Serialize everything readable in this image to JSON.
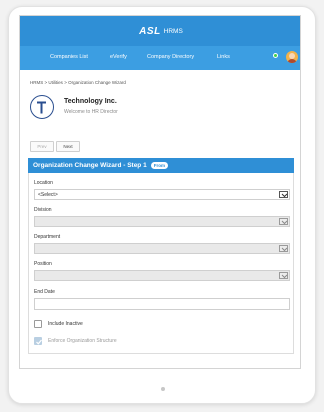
{
  "app": {
    "brand_logo": "ASL",
    "brand_name": "HRMS"
  },
  "nav": {
    "items": [
      {
        "label": "Companies List"
      },
      {
        "label": "eVerify"
      },
      {
        "label": "Company Directory"
      },
      {
        "label": "Links"
      }
    ]
  },
  "breadcrumb": {
    "items": [
      "HRMS",
      ">",
      "Utilities",
      ">",
      "Organization Change Wizard"
    ]
  },
  "company": {
    "logo_letter": "T",
    "name": "Technology Inc.",
    "welcome": "Welcome to HR Director"
  },
  "buttons": {
    "prev": "Prev",
    "next": "Next"
  },
  "wizard": {
    "title": "Organization Change Wizard - Step 1",
    "badge": "From"
  },
  "form": {
    "location": {
      "label": "Location",
      "value": "<Select>"
    },
    "division": {
      "label": "Division",
      "value": ""
    },
    "department": {
      "label": "Department",
      "value": ""
    },
    "position": {
      "label": "Position",
      "value": ""
    },
    "end_date": {
      "label": "End Date",
      "value": ""
    },
    "include_inactive": {
      "label": "Include Inactive",
      "checked": false
    },
    "enforce_structure": {
      "label": "Enforce Organization Structure",
      "checked": true
    }
  },
  "colors": {
    "header_blue": "#2f8fd6",
    "nav_blue": "#3c9ee2",
    "status_dot": "#43d14a"
  },
  "icons": {
    "select_arrow": "chevron-down-icon",
    "checkmark": "check-icon",
    "avatar": "user-avatar",
    "logo": "company-logo-icon"
  }
}
